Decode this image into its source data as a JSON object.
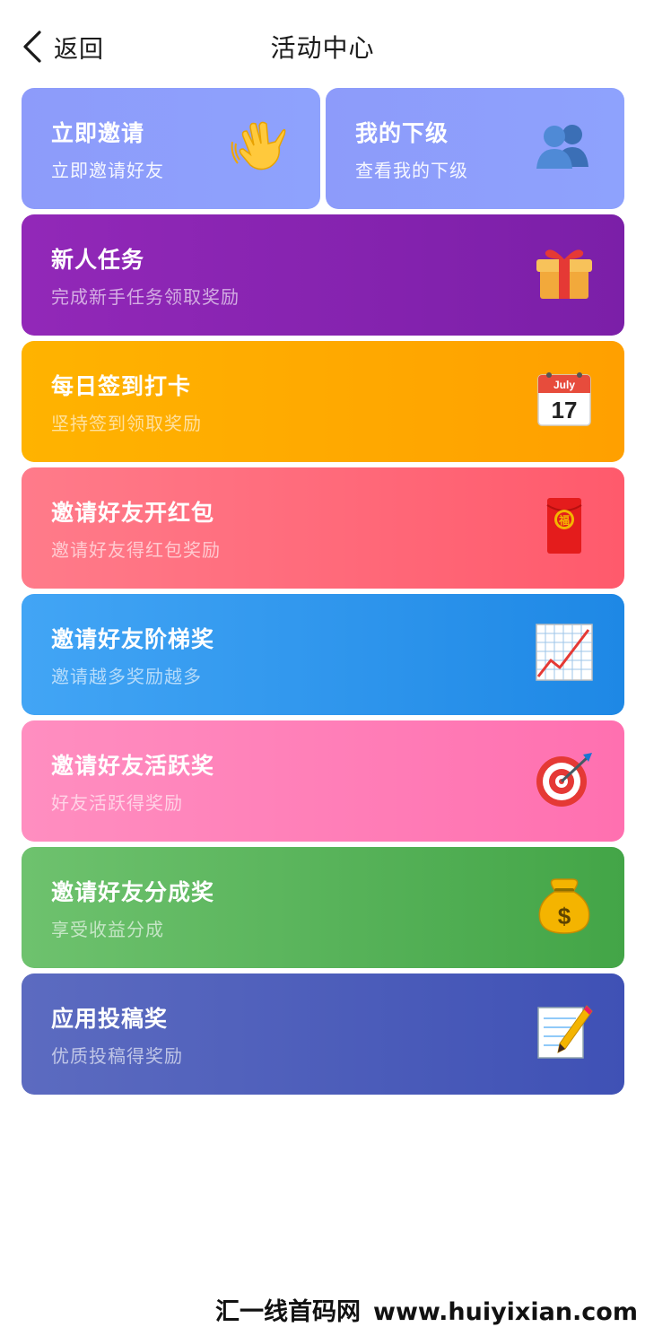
{
  "header": {
    "back_label": "返回",
    "title": "活动中心"
  },
  "cards": {
    "invite": {
      "title": "立即邀请",
      "subtitle": "立即邀请好友",
      "icon": "waving-hand-icon"
    },
    "subordinates": {
      "title": "我的下级",
      "subtitle": "查看我的下级",
      "icon": "two-people-icon"
    },
    "newbie": {
      "title": "新人任务",
      "subtitle": "完成新手任务领取奖励",
      "icon": "gift-icon"
    },
    "checkin": {
      "title": "每日签到打卡",
      "subtitle": "坚持签到领取奖励",
      "icon": "calendar-icon",
      "calendar_month": "July",
      "calendar_day": "17"
    },
    "redpack": {
      "title": "邀请好友开红包",
      "subtitle": "邀请好友得红包奖励",
      "icon": "red-envelope-icon",
      "envelope_char": "福"
    },
    "ladder": {
      "title": "邀请好友阶梯奖",
      "subtitle": "邀请越多奖励越多",
      "icon": "chart-increasing-icon"
    },
    "active": {
      "title": "邀请好友活跃奖",
      "subtitle": "好友活跃得奖励",
      "icon": "target-icon"
    },
    "share": {
      "title": "邀请好友分成奖",
      "subtitle": "享受收益分成",
      "icon": "money-bag-icon"
    },
    "submit": {
      "title": "应用投稿奖",
      "subtitle": "优质投稿得奖励",
      "icon": "memo-icon"
    }
  },
  "watermark": {
    "name": "汇一线首码网",
    "url": "www.huiyixian.com"
  },
  "colors": {
    "invite": "#8d9bfa",
    "newbie": "#8a24b3",
    "checkin": "#ffab00",
    "redpack": "#ff6b7b",
    "ladder": "#2f97f0",
    "active": "#ff80b8",
    "share": "#58b55b",
    "submit": "#4e5dba"
  }
}
